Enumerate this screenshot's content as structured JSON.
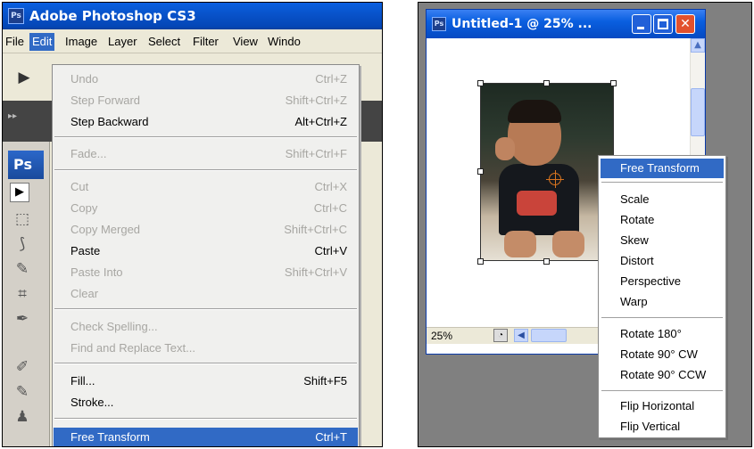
{
  "left_window": {
    "app_title": "Adobe Photoshop CS3",
    "logo_text": "Ps",
    "menubar": [
      "File",
      "Edit",
      "Image",
      "Layer",
      "Select",
      "Filter",
      "View",
      "Windo"
    ],
    "active_menu": "Edit",
    "tools_tab": "Ps"
  },
  "edit_menu": {
    "items": [
      {
        "label": "Undo",
        "shortcut": "Ctrl+Z",
        "enabled": false
      },
      {
        "label": "Step Forward",
        "shortcut": "Shift+Ctrl+Z",
        "enabled": false
      },
      {
        "label": "Step Backward",
        "shortcut": "Alt+Ctrl+Z",
        "enabled": true
      },
      {
        "label": "Fade...",
        "shortcut": "Shift+Ctrl+F",
        "enabled": false
      },
      {
        "label": "Cut",
        "shortcut": "Ctrl+X",
        "enabled": false
      },
      {
        "label": "Copy",
        "shortcut": "Ctrl+C",
        "enabled": false
      },
      {
        "label": "Copy Merged",
        "shortcut": "Shift+Ctrl+C",
        "enabled": false
      },
      {
        "label": "Paste",
        "shortcut": "Ctrl+V",
        "enabled": true
      },
      {
        "label": "Paste Into",
        "shortcut": "Shift+Ctrl+V",
        "enabled": false
      },
      {
        "label": "Clear",
        "shortcut": "",
        "enabled": false
      },
      {
        "label": "Check Spelling...",
        "shortcut": "",
        "enabled": false
      },
      {
        "label": "Find and Replace Text...",
        "shortcut": "",
        "enabled": false
      },
      {
        "label": "Fill...",
        "shortcut": "Shift+F5",
        "enabled": true
      },
      {
        "label": "Stroke...",
        "shortcut": "",
        "enabled": true
      },
      {
        "label": "Free Transform",
        "shortcut": "Ctrl+T",
        "enabled": true
      }
    ],
    "highlighted": "Free Transform"
  },
  "document_window": {
    "title": "Untitled-1 @ 25% ...",
    "zoom": "25%",
    "logo_text": "Ps"
  },
  "context_menu": {
    "items": [
      "Free Transform",
      "Scale",
      "Rotate",
      "Skew",
      "Distort",
      "Perspective",
      "Warp",
      "Rotate 180°",
      "Rotate 90° CW",
      "Rotate 90° CCW",
      "Flip Horizontal",
      "Flip Vertical"
    ],
    "highlighted": "Free Transform"
  },
  "colors": {
    "titlebar_blue": "#0852c9",
    "highlight": "#316ac5",
    "close_button": "#e2512d"
  }
}
